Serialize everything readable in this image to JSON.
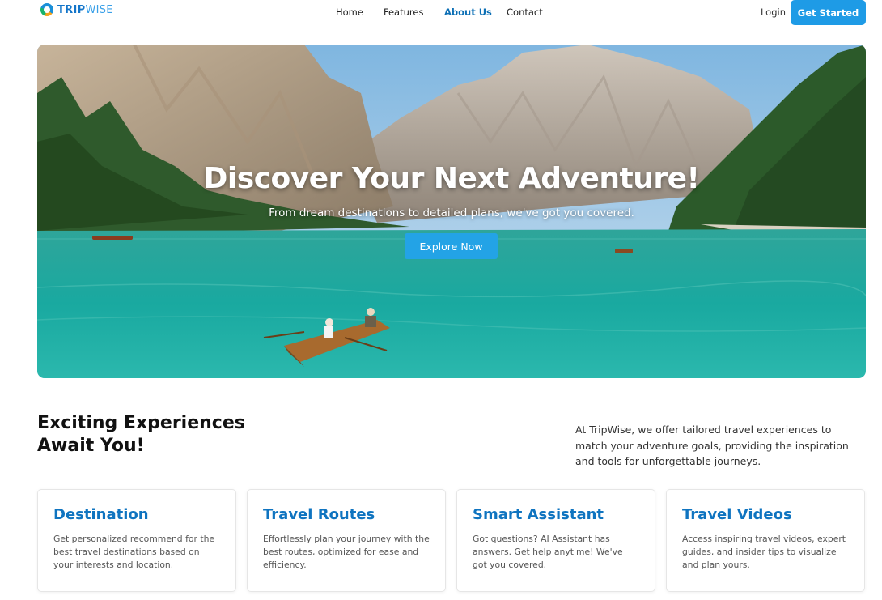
{
  "nav": {
    "logo": {
      "part1": "TRIP",
      "part2": "WISE"
    },
    "links": [
      {
        "label": "Home",
        "active": false
      },
      {
        "label": "Features",
        "active": false
      },
      {
        "label": "About Us",
        "active": true
      },
      {
        "label": "Contact",
        "active": false
      }
    ],
    "login_label": "Login",
    "cta_label": "Get Started"
  },
  "hero": {
    "title": "Discover Your Next Adventure!",
    "subtitle": "From dream destinations to detailed plans, we've got you covered.",
    "button_label": "Explore Now"
  },
  "experiences": {
    "title_line1": "Exciting Experiences",
    "title_line2": "Await You!",
    "description": "At TripWise, we offer tailored travel experiences to match your adventure goals, providing the inspiration and tools for unforgettable journeys."
  },
  "cards": [
    {
      "title": "Destination",
      "text": "Get personalized recommend for the best travel destinations based on your interests and location."
    },
    {
      "title": "Travel Routes",
      "text": "Effortlessly plan your journey with the best routes, optimized for ease and efficiency."
    },
    {
      "title": "Smart Assistant",
      "text": "Got questions? AI Assistant has answers. Get help anytime! We've got you covered."
    },
    {
      "title": "Travel Videos",
      "text": "Access inspiring travel videos, expert guides, and insider tips to visualize and plan yours."
    }
  ],
  "colors": {
    "brand": "#1375c9",
    "accent": "#1e9be6",
    "card_title": "#0f74c0"
  }
}
